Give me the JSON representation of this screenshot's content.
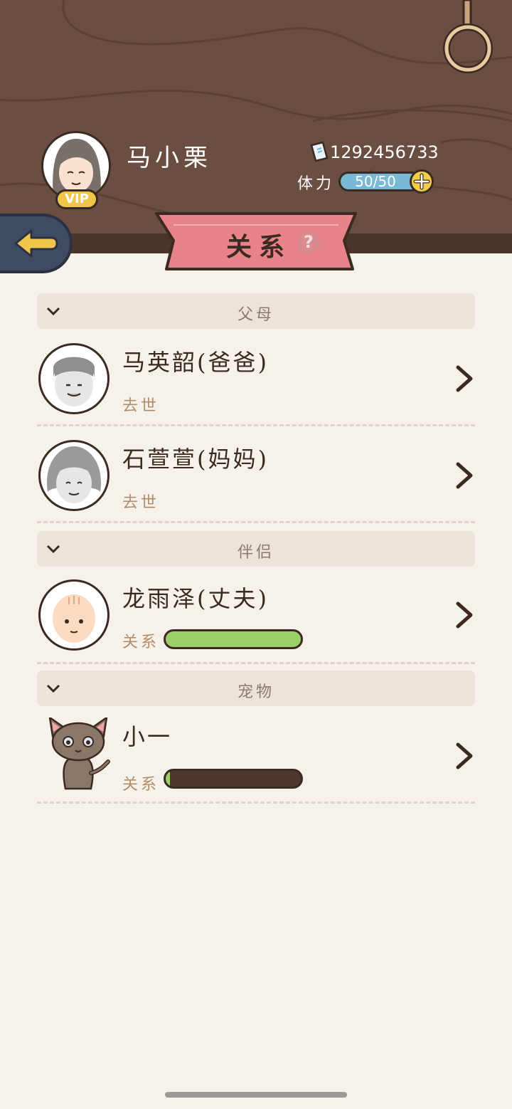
{
  "profile": {
    "name": "马小栗",
    "vip": "VIP",
    "coins": "1292456733",
    "stamina_label": "体力",
    "stamina_value": "50/50",
    "stamina_fraction": 1.0
  },
  "page": {
    "title": "关系",
    "help": "?"
  },
  "sections": [
    {
      "label": "父母",
      "items": [
        {
          "name": "马英韶(爸爸)",
          "status": "去世"
        },
        {
          "name": "石萱萱(妈妈)",
          "status": "去世"
        }
      ]
    },
    {
      "label": "伴侣",
      "items": [
        {
          "name": "龙雨泽(丈夫)",
          "relation_label": "关系",
          "relation_fraction": 1.0
        }
      ]
    },
    {
      "label": "宠物",
      "items": [
        {
          "name": "小一",
          "relation_label": "关系",
          "relation_fraction": 0.03
        }
      ]
    }
  ],
  "colors": {
    "header_bg": "#6a4e42",
    "ribbon": "#e8838a",
    "relation_fill": "#9ed06a",
    "stamina_fill": "#7ab9d3"
  },
  "icons": [
    "back-arrow-icon",
    "ticket-icon",
    "plus-icon",
    "help-icon",
    "chevron-down-icon",
    "chevron-right-icon",
    "hook-icon"
  ]
}
